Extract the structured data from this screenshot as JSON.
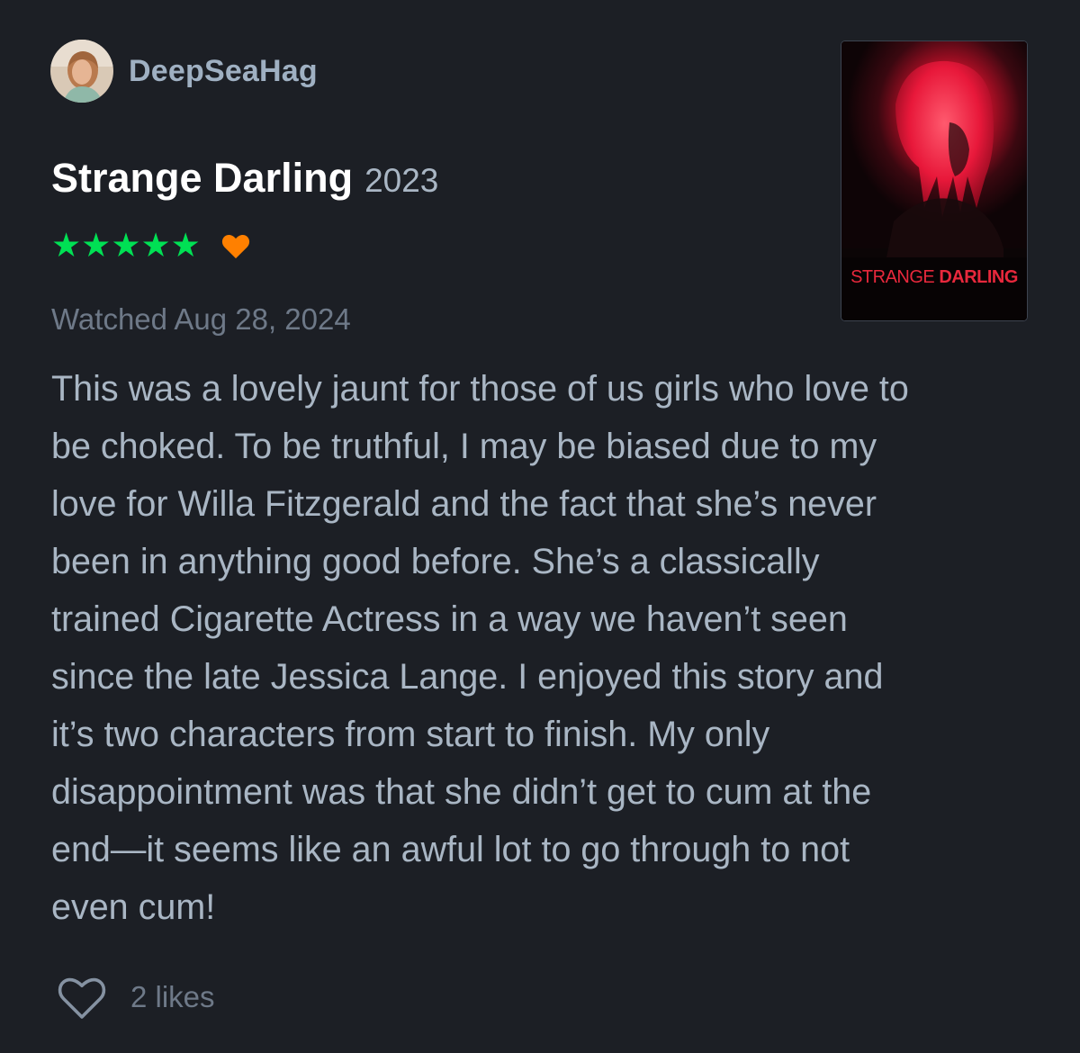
{
  "user": {
    "username": "DeepSeaHag",
    "avatar_icon": "user-avatar"
  },
  "film": {
    "title": "Strange Darling",
    "year": "2023",
    "poster_text_light": "STRANGE ",
    "poster_text_bold": "DARLING"
  },
  "rating": {
    "stars_display": "★★★★★",
    "stars_value": 5,
    "stars_max": 5,
    "liked": true,
    "star_color": "#00e054",
    "heart_color": "#ff8000"
  },
  "watched_label": "Watched Aug 28, 2024",
  "review": {
    "lines": [
      "This was a lovely jaunt for those of us girls who love to",
      "be choked. To be truthful, I may be biased due to my",
      "love for Willa Fitzgerald and the fact that she’s never",
      "been in anything good before. She’s a classically",
      "trained Cigarette Actress in a way we haven’t seen",
      "since the late Jessica Lange. I enjoyed this story and",
      "it’s two characters from start to finish. My only",
      "disappointment was that she didn’t get to cum at the",
      "end—it seems like an awful lot to go through to not",
      "even cum!"
    ]
  },
  "likes": {
    "label": "2 likes",
    "icon": "heart-outline-icon"
  },
  "colors": {
    "background": "#1c1f25",
    "username": "#9fb0c2",
    "body_text": "#a9b6c4",
    "muted_text": "#6e7988"
  }
}
